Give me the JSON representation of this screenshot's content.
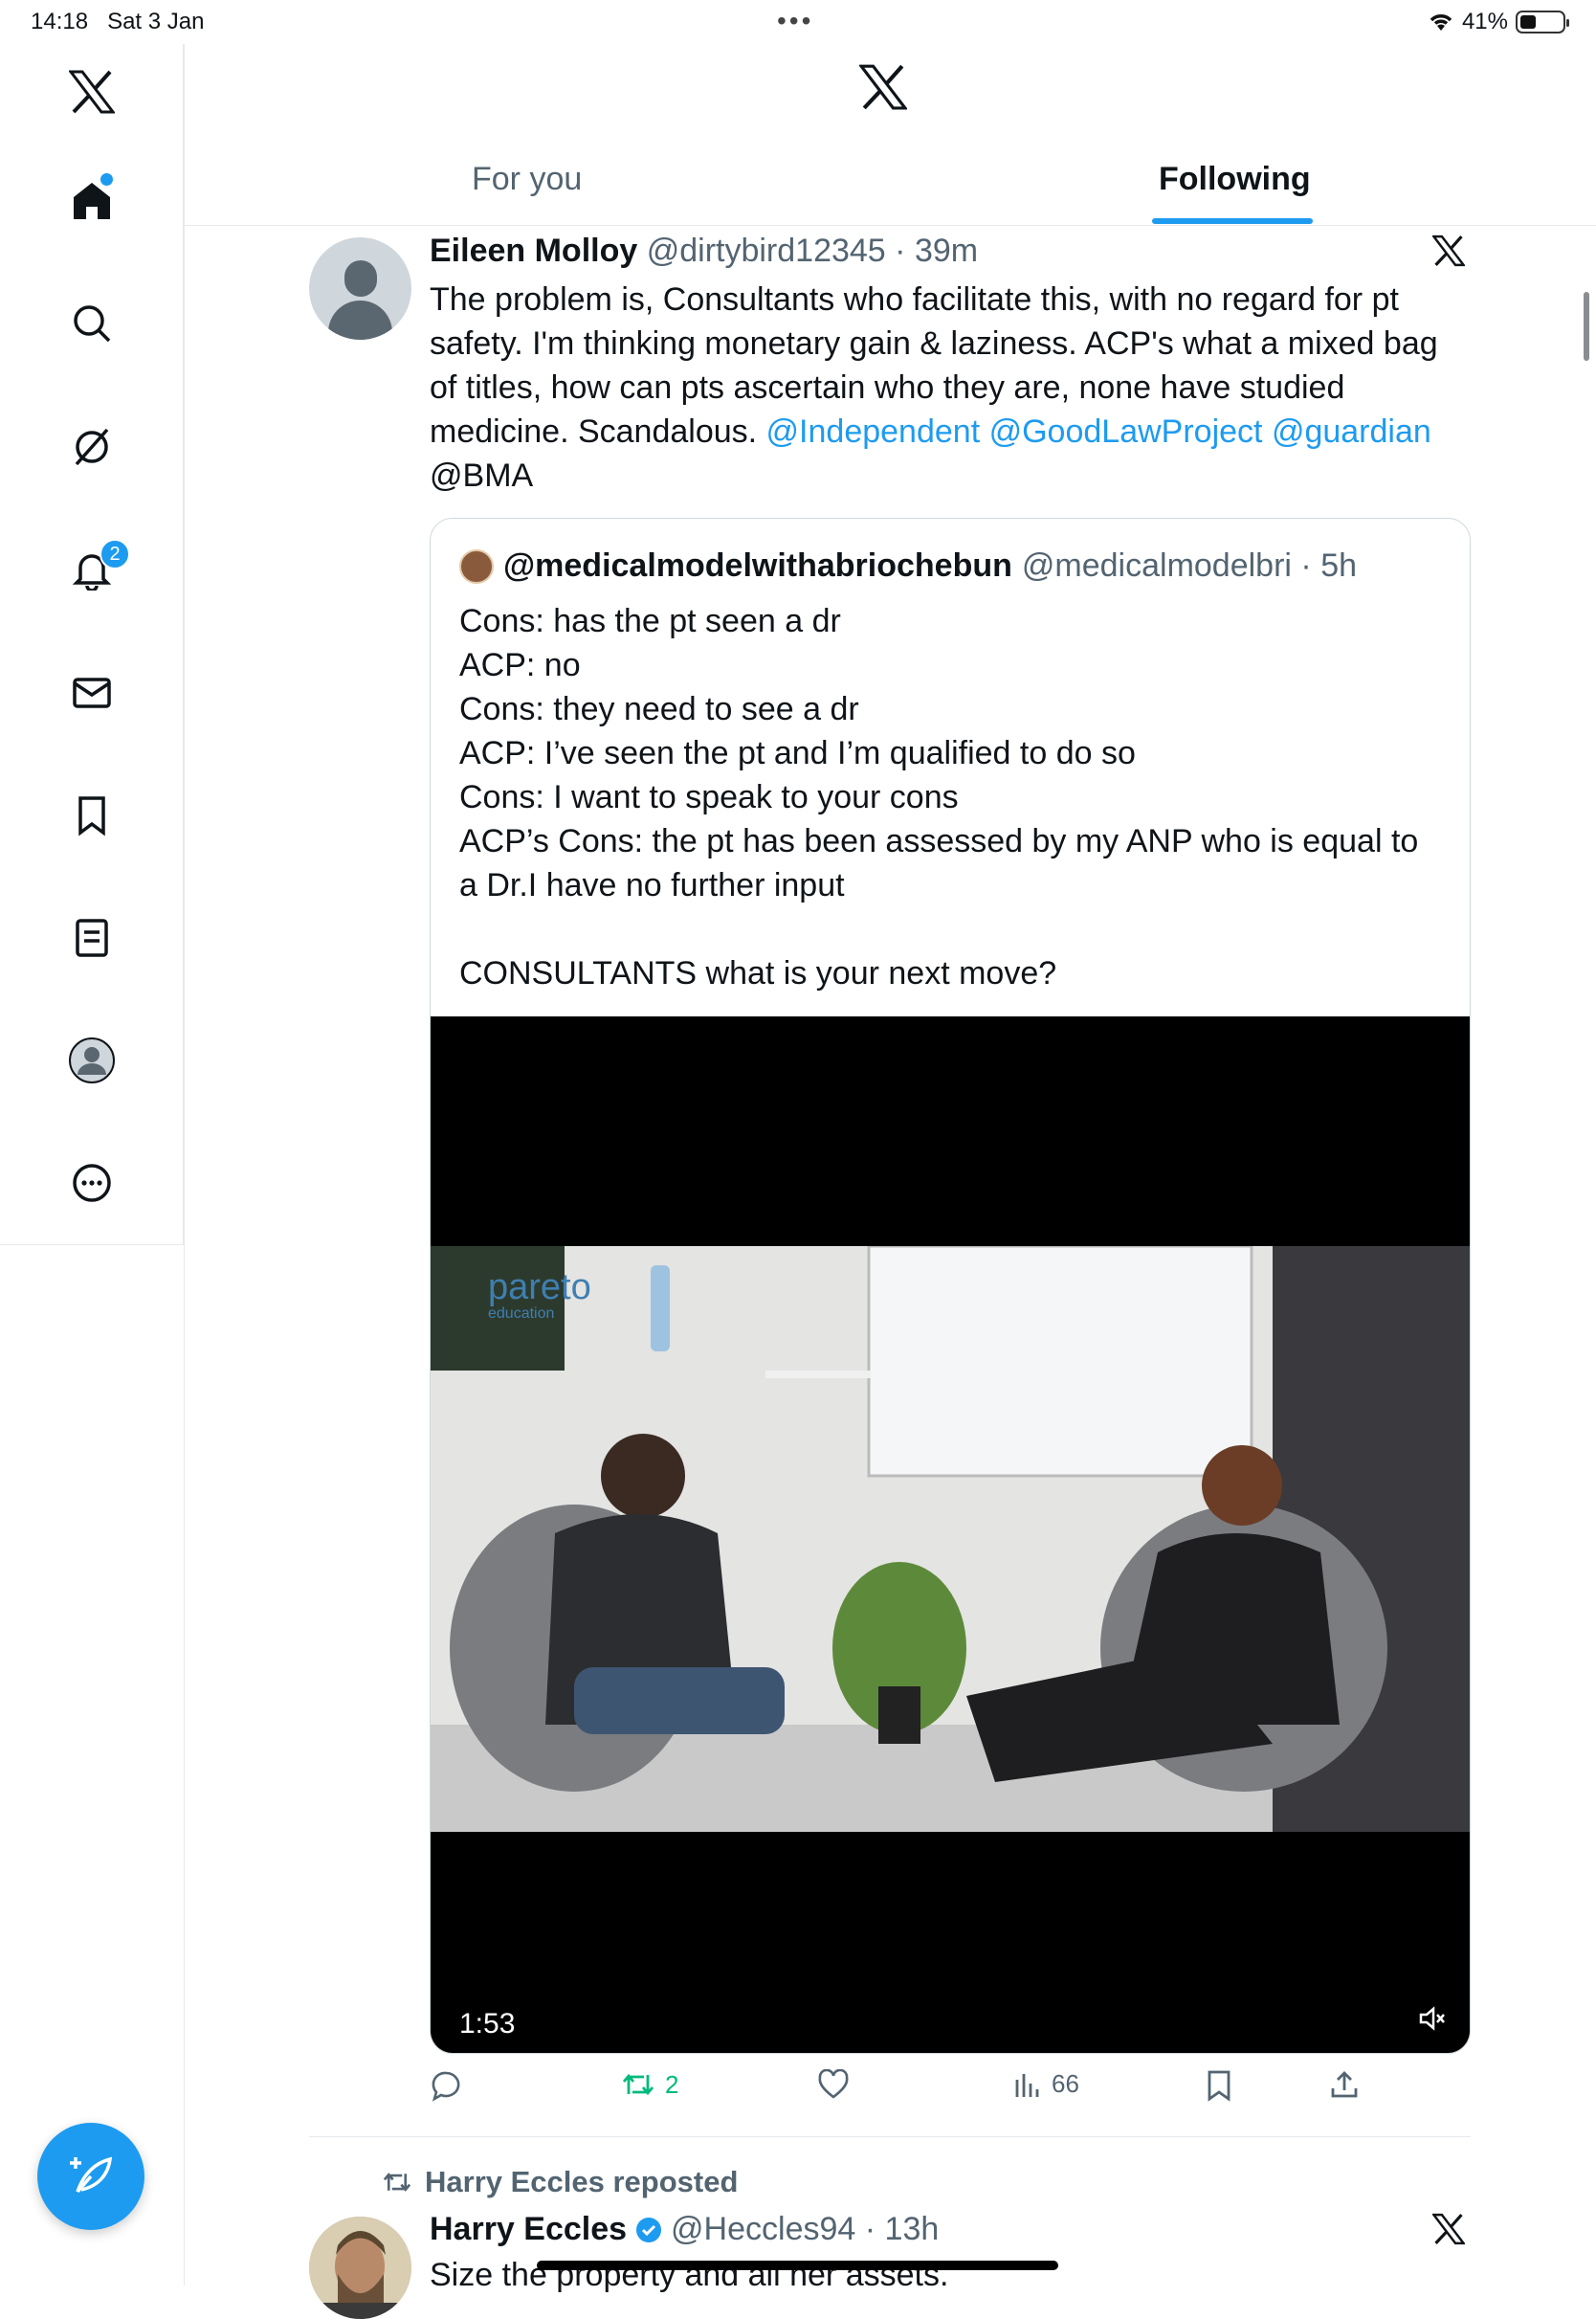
{
  "status_bar": {
    "time": "14:18",
    "date": "Sat 3 Jan",
    "battery": "41%"
  },
  "tabs": {
    "for_you": "For you",
    "following": "Following"
  },
  "sidebar": {
    "notifications_badge": "2"
  },
  "tweet": {
    "name": "Eileen Molloy",
    "handle": "@dirtybird12345",
    "time": "39m",
    "text_plain": "The problem is, Consultants who facilitate this, with no regard for pt safety. I'm thinking monetary gain & laziness. ACP's what a mixed bag of titles, how can pts ascertain who they are, none have studied medicine. Scandalous. ",
    "mentions": [
      "@Independent",
      "@GoodLawProject",
      "@guardian"
    ],
    "text_end": "@BMA",
    "quote": {
      "name": "@medicalmodelwithabriochebun",
      "handle": "@medicalmodelbri",
      "time": "5h",
      "lines": [
        "Cons: has the pt seen a dr",
        "ACP: no",
        "Cons: they need to see a dr",
        "ACP: I’ve seen the pt and I’m qualified to do so",
        "Cons: I want to speak to your cons",
        "ACP’s Cons: the pt has been assessed by my ANP who is equal to a Dr.I have no further input",
        "",
        "CONSULTANTS what is your next move?"
      ],
      "video": {
        "duration": "1:53",
        "watermark": "pareto",
        "watermark_sub": "education"
      }
    },
    "actions": {
      "reposts": "2",
      "views": "66"
    }
  },
  "next_tweet": {
    "reposted_by": "Harry Eccles reposted",
    "name": "Harry Eccles",
    "handle": "@Heccles94",
    "time": "13h",
    "text": "Size the property and all her assets."
  }
}
